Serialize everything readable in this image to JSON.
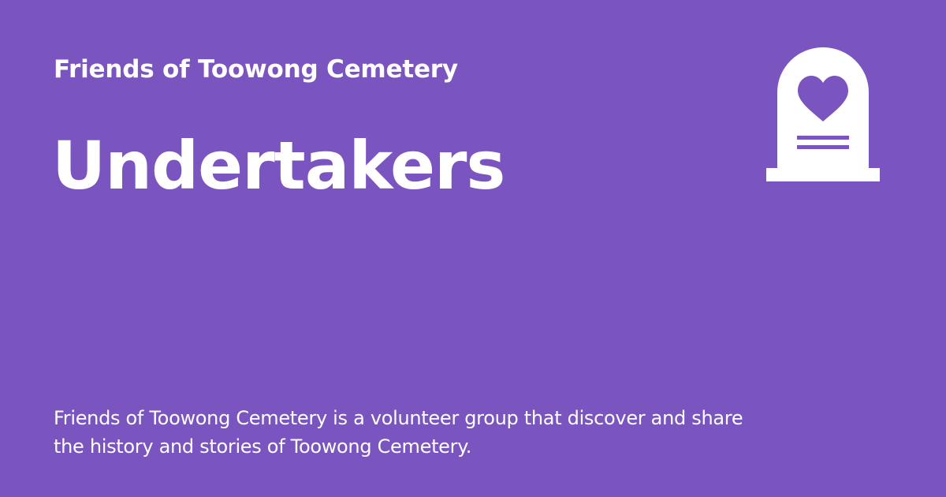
{
  "brand": {
    "org_name": "Friends of Toowong Cemetery",
    "logo_icon": "tombstone-heart-icon",
    "background_color": "#7b55bf",
    "text_color": "#ffffff"
  },
  "page": {
    "title": "Undertakers",
    "description": "Friends of Toowong Cemetery is a volunteer group that discover and share the history and stories of Toowong Cemetery."
  }
}
